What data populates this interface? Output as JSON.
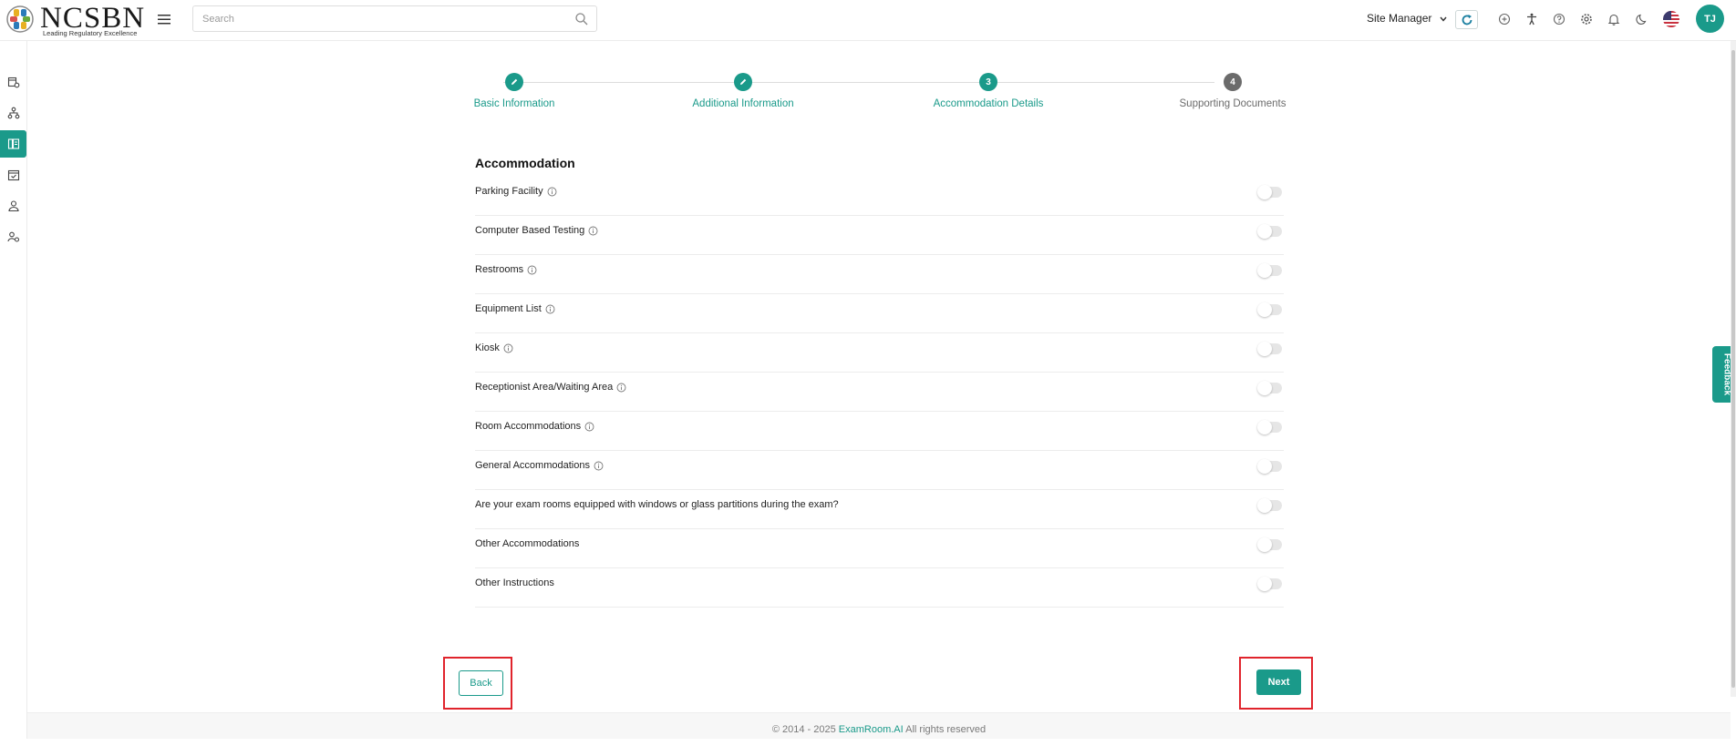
{
  "header": {
    "logo_text": "NCSBN",
    "logo_tagline": "Leading Regulatory Excellence",
    "search_placeholder": "Search",
    "role_label": "Site Manager",
    "avatar_initials": "TJ",
    "icons": [
      "plus-circle-icon",
      "accessibility-icon",
      "help-icon",
      "settings-icon",
      "bell-icon",
      "moon-icon",
      "us-flag-icon"
    ]
  },
  "sidebar": {
    "items": [
      {
        "icon": "calendar-settings-icon",
        "active": false
      },
      {
        "icon": "hierarchy-icon",
        "active": false
      },
      {
        "icon": "site-list-icon",
        "active": true
      },
      {
        "icon": "calendar-check-icon",
        "active": false
      },
      {
        "icon": "user-icon",
        "active": false
      },
      {
        "icon": "user-settings-icon",
        "active": false
      }
    ]
  },
  "stepper": {
    "steps": [
      {
        "number": "",
        "label": "Basic Information",
        "state": "completed"
      },
      {
        "number": "",
        "label": "Additional Information",
        "state": "completed"
      },
      {
        "number": "3",
        "label": "Accommodation Details",
        "state": "active"
      },
      {
        "number": "4",
        "label": "Supporting Documents",
        "state": "pending"
      }
    ]
  },
  "accommodation": {
    "title": "Accommodation",
    "items": [
      {
        "label": "Parking Facility",
        "info": true,
        "enabled": false
      },
      {
        "label": "Computer Based Testing",
        "info": true,
        "enabled": false
      },
      {
        "label": "Restrooms",
        "info": true,
        "enabled": false
      },
      {
        "label": "Equipment List",
        "info": true,
        "enabled": false
      },
      {
        "label": "Kiosk",
        "info": true,
        "enabled": false
      },
      {
        "label": "Receptionist Area/Waiting Area",
        "info": true,
        "enabled": false
      },
      {
        "label": "Room Accommodations",
        "info": true,
        "enabled": false
      },
      {
        "label": "General Accommodations",
        "info": true,
        "enabled": false
      },
      {
        "label": "Are your exam rooms equipped with windows or glass partitions during the exam?",
        "info": false,
        "enabled": false
      },
      {
        "label": "Other Accommodations",
        "info": false,
        "enabled": false
      },
      {
        "label": "Other Instructions",
        "info": false,
        "enabled": false
      }
    ]
  },
  "actions": {
    "back_label": "Back",
    "next_label": "Next"
  },
  "footer": {
    "copyright": "© 2014 - 2025 ",
    "brand": "ExamRoom.AI",
    "rights": " All rights reserved"
  },
  "feedback_label": "Feedback",
  "colors": {
    "accent": "#1a9a8a",
    "pending_step": "#6b6b6b",
    "highlight": "#e0242c"
  }
}
